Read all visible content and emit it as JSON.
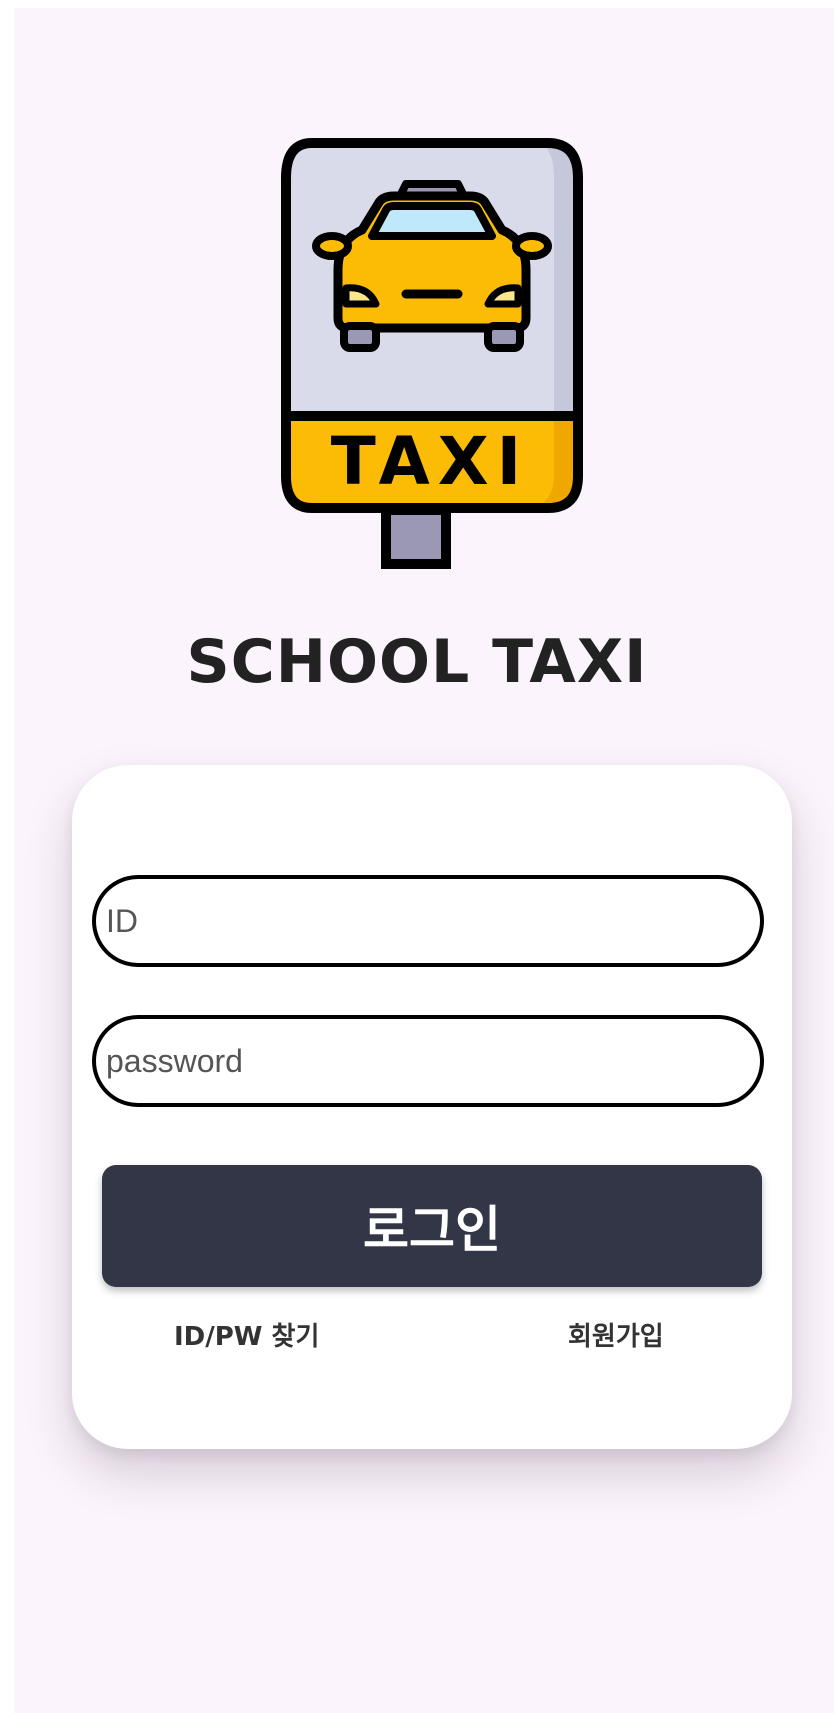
{
  "app": {
    "title": "SCHOOL TAXI"
  },
  "logo": {
    "sign_text": "TAXI",
    "icon": "taxi-sign-icon",
    "colors": {
      "panel": "#d9dbeb",
      "taxi": "#fcbc05",
      "windshield": "#bfe9fb",
      "outline": "#000000"
    }
  },
  "login_form": {
    "id_placeholder": "ID",
    "password_placeholder": "password",
    "login_button_label": "로그인",
    "find_id_pw_link": "ID/PW 찾기",
    "signup_link": "회원가입"
  },
  "colors": {
    "background": "#fcf4fc",
    "card": "#ffffff",
    "button": "#323647",
    "button_text": "#ffffff"
  }
}
